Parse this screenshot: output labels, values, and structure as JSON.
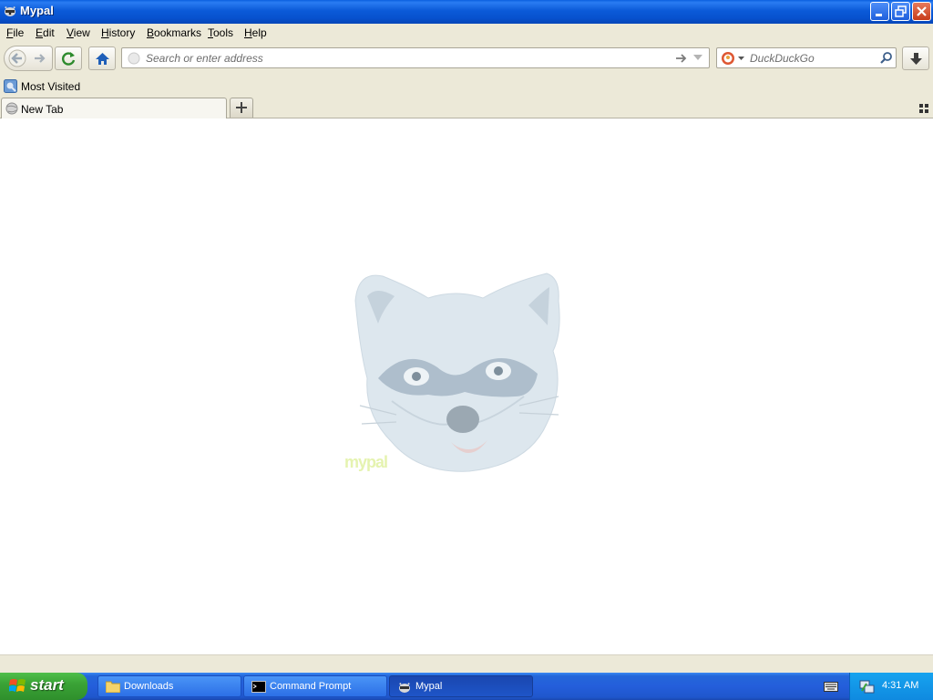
{
  "window": {
    "title": "Mypal"
  },
  "menu": {
    "items": [
      {
        "label": "File",
        "accel": "F",
        "rest": "ile"
      },
      {
        "label": "Edit",
        "accel": "E",
        "rest": "dit"
      },
      {
        "label": "View",
        "accel": "V",
        "rest": "iew"
      },
      {
        "label": "History",
        "accel": "H",
        "rest": "istory"
      },
      {
        "label": "Bookmarks",
        "accel": "B",
        "rest": "ookmarks"
      },
      {
        "label": "Tools",
        "accel": "T",
        "rest": "ools"
      },
      {
        "label": "Help",
        "accel": "H",
        "rest": "elp"
      }
    ]
  },
  "toolbar": {
    "address_placeholder": "Search or enter address",
    "search_engine": "DuckDuckGo"
  },
  "bookmarks": {
    "most_visited": "Most Visited"
  },
  "tabs": [
    {
      "label": "New Tab"
    }
  ],
  "content": {
    "logo_text": "mypal"
  },
  "taskbar": {
    "start_label": "start",
    "tasks": [
      {
        "label": "Downloads",
        "icon": "folder-icon"
      },
      {
        "label": "Command Prompt",
        "icon": "cmd-icon"
      },
      {
        "label": "Mypal",
        "icon": "mypal-icon"
      }
    ],
    "clock": "4:31 AM"
  },
  "colors": {
    "xp_blue": "#0b5ad8",
    "start_green": "#3aa336",
    "chrome_bg": "#ece9d8"
  }
}
